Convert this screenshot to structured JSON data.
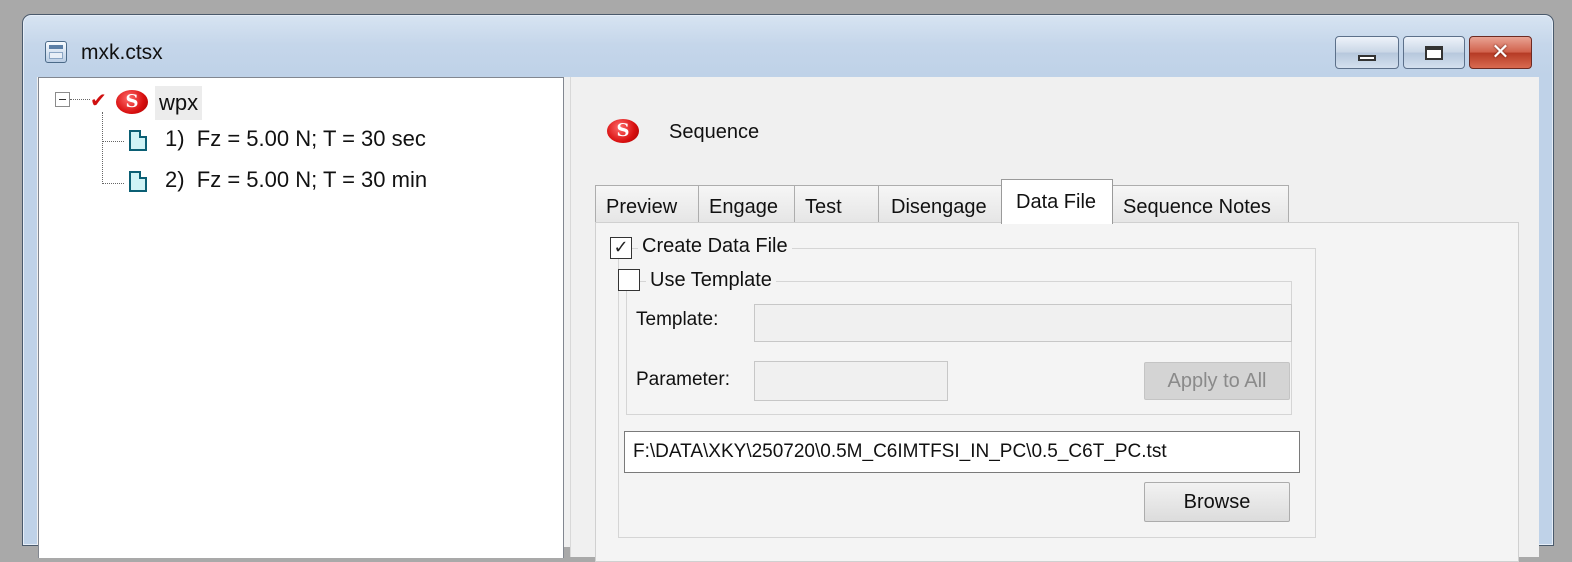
{
  "window": {
    "title": "mxk.ctsx",
    "minimize_label": "minimize",
    "maximize_label": "maximize",
    "close_glyph": "✕"
  },
  "tree": {
    "root": {
      "label": "wpx",
      "icon_letter": "S",
      "checked": true,
      "check_glyph": "✔",
      "expanded": true
    },
    "children": [
      {
        "label": "1)  Fz = 5.00 N; T = 30 sec",
        "icon": "document-icon"
      },
      {
        "label": "2)  Fz = 5.00 N; T = 30 min",
        "icon": "document-icon"
      }
    ]
  },
  "panel": {
    "icon_letter": "S",
    "title": "Sequence",
    "tabs": [
      {
        "label": "Preview"
      },
      {
        "label": "Engage"
      },
      {
        "label": "Test"
      },
      {
        "label": "Disengage"
      },
      {
        "label": "Data File"
      },
      {
        "label": "Sequence Notes"
      }
    ],
    "active_tab": "Data File",
    "data_file": {
      "create_data_file_label": "Create Data File",
      "create_data_file_checked": true,
      "create_check_glyph": "✓",
      "use_template_label": "Use Template",
      "use_template_checked": false,
      "template_label": "Template:",
      "template_value": "",
      "parameter_label": "Parameter:",
      "parameter_value": "",
      "apply_to_all_label": "Apply to All",
      "path_value": "F:\\DATA\\XKY\\250720\\0.5M_C6IMTFSI_IN_PC\\0.5_C6T_PC.tst",
      "browse_label": "Browse"
    }
  },
  "colors": {
    "titlebar": "#c5d6ea",
    "close_button": "#c94a33",
    "sequence_icon": "#d80f0f",
    "document_icon": "#0b5f74"
  }
}
